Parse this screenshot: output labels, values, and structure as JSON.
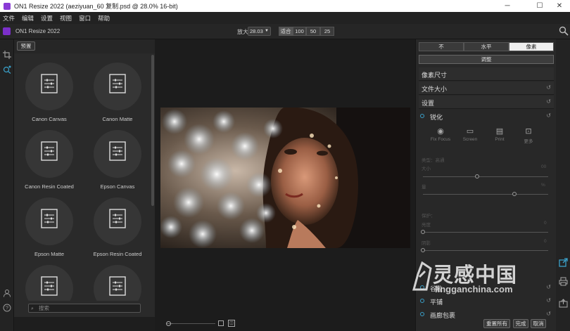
{
  "window": {
    "title": "ON1 Resize 2022 (aeziyuan_60 复制.psd @ 28.0% 16-bit)",
    "minimize": "─",
    "maximize": "☐",
    "close": "✕"
  },
  "menu": [
    "文件",
    "编辑",
    "设置",
    "视图",
    "窗口",
    "帮助"
  ],
  "toolbar": {
    "app_name": "ON1 Resize 2022",
    "zoom_label": "放大",
    "zoom_value": "28.03",
    "zoom_buttons": [
      "适合",
      "100",
      "50",
      "25"
    ]
  },
  "presets": {
    "header_button": "预置",
    "items": [
      "Canon Canvas",
      "Canon Matte",
      "Canon Resin Coated",
      "Epson Canvas",
      "Epson Matte",
      "Epson Resin Coated",
      "",
      ""
    ],
    "search_placeholder": "搜索"
  },
  "right_panel": {
    "tabs": [
      "不",
      "水平",
      "像素"
    ],
    "active_tab": 2,
    "adjust_button": "调整",
    "sections": {
      "pixel_dimensions": "像素尺寸",
      "document_size": "文件大小",
      "settings": "设置",
      "sharpen": "锐化",
      "grain": "谷粒",
      "tiling": "平铺",
      "gallery_wrap": "画廊包裹"
    },
    "sharpen_types": [
      "Fix Focus",
      "Screen",
      "Print",
      "更多"
    ],
    "sharpen_labels": {
      "type": "类型：高通",
      "amount": "大小",
      "amount_value": "00",
      "amount_level": 0.43,
      "threshold": "量",
      "threshold_value": "%",
      "threshold_level": 0.73,
      "protect": "保护：",
      "protect_a": "亮度",
      "protect_a_value": "0",
      "protect_a_level": 0,
      "protect_b": "阴影",
      "protect_b_value": "0",
      "protect_b_level": 0
    },
    "reset_glyph": "↺"
  },
  "actions": {
    "reset_all": "重置所有",
    "done": "完成",
    "cancel": "取消"
  },
  "watermark": {
    "title": "灵感中国",
    "url": "lingganchina.com"
  }
}
